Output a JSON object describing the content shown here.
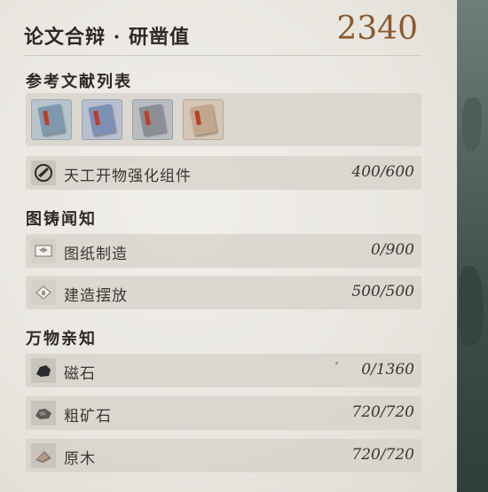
{
  "header": {
    "title": "论文合辩 · 研凿值",
    "score": "2340"
  },
  "sections": {
    "references": {
      "title": "参考文献列表"
    },
    "blueprints": {
      "title": "图铸闻知"
    },
    "materials": {
      "title": "万物亲知"
    }
  },
  "books": [
    {
      "name": "book-1",
      "color": "#7f98ad"
    },
    {
      "name": "book-2",
      "color": "#7d8fb5"
    },
    {
      "name": "book-3",
      "color": "#8b8e93"
    },
    {
      "name": "book-4",
      "color": "#c2a78f"
    }
  ],
  "rows": {
    "enhance": {
      "label": "天工开物强化组件",
      "value": "400/600",
      "icon": "scroll-icon"
    },
    "craft": {
      "label": "图纸制造",
      "value": "0/900",
      "icon": "blueprint-icon"
    },
    "build": {
      "label": "建造摆放",
      "value": "500/500",
      "icon": "building-icon"
    },
    "magnetite": {
      "label": "磁石",
      "value": "0/1360",
      "icon": "magnetite-icon"
    },
    "ore": {
      "label": "粗矿石",
      "value": "720/720",
      "icon": "ore-icon"
    },
    "wood": {
      "label": "原木",
      "value": "720/720",
      "icon": "log-icon"
    }
  }
}
